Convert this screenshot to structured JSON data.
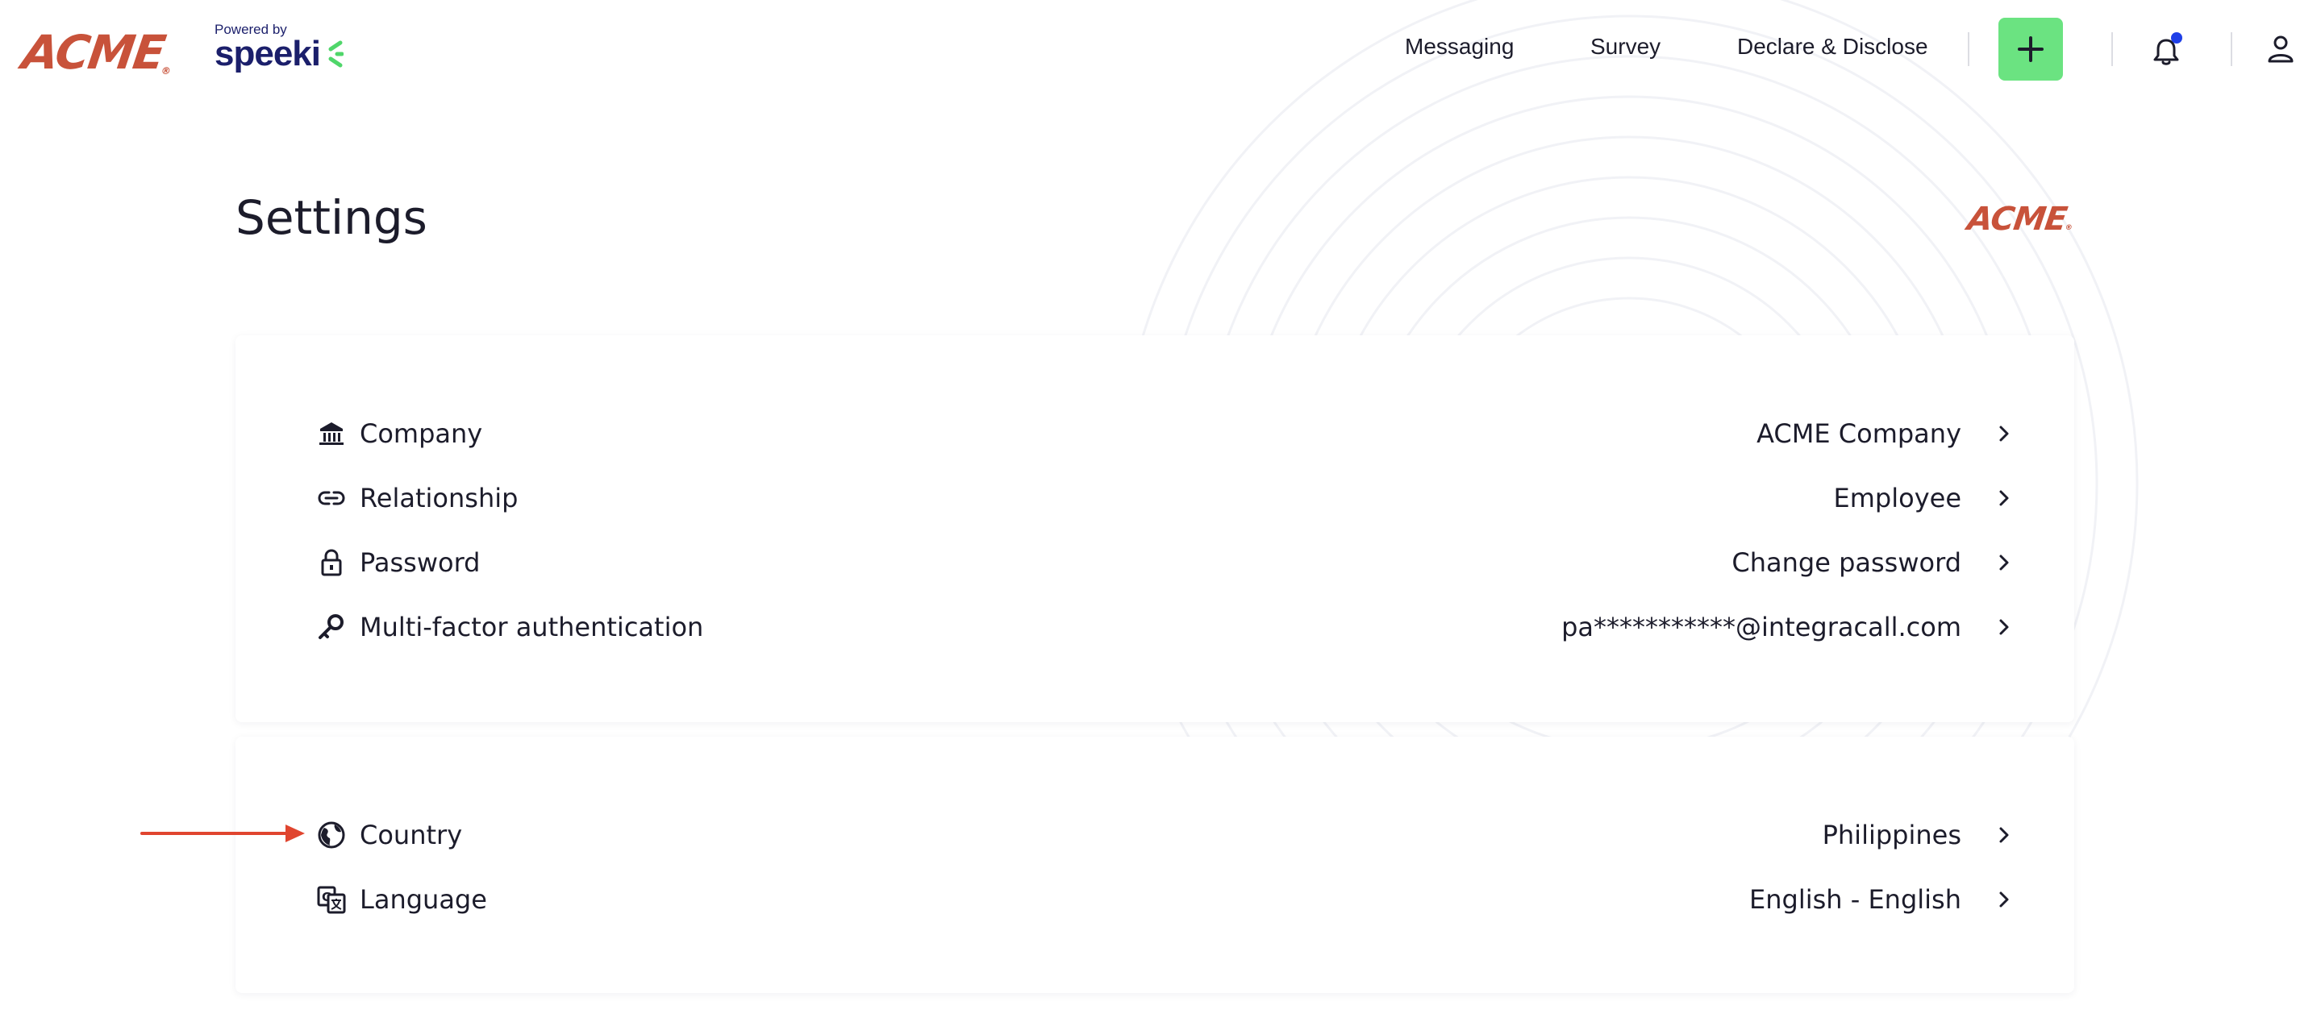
{
  "brand": {
    "logo_text": "ACME",
    "powered_by": "Powered by",
    "speeki": "speeki"
  },
  "nav": {
    "items": [
      {
        "label": "Messaging"
      },
      {
        "label": "Survey"
      },
      {
        "label": "Declare & Disclose"
      }
    ]
  },
  "header_icons": [
    "plus-icon",
    "bell-icon",
    "user-icon"
  ],
  "page": {
    "title": "Settings",
    "company_logo": "ACME"
  },
  "account_settings": [
    {
      "icon": "bank-icon",
      "label": "Company",
      "value": "ACME Company"
    },
    {
      "icon": "link-icon",
      "label": "Relationship",
      "value": "Employee"
    },
    {
      "icon": "lock-icon",
      "label": "Password",
      "value": "Change password"
    },
    {
      "icon": "key-icon",
      "label": "Multi-factor authentication",
      "value": "pa***********@integracall.com"
    }
  ],
  "locale_settings": [
    {
      "icon": "globe-icon",
      "label": "Country",
      "value": "Philippines"
    },
    {
      "icon": "translate-icon",
      "label": "Language",
      "value": "English - English"
    }
  ],
  "colors": {
    "accent_green": "#6be381",
    "brand_red": "#c8523a",
    "speeki_navy": "#1b1f6b",
    "notification_dot": "#1f3fe8",
    "annotation_arrow": "#e0452f"
  }
}
